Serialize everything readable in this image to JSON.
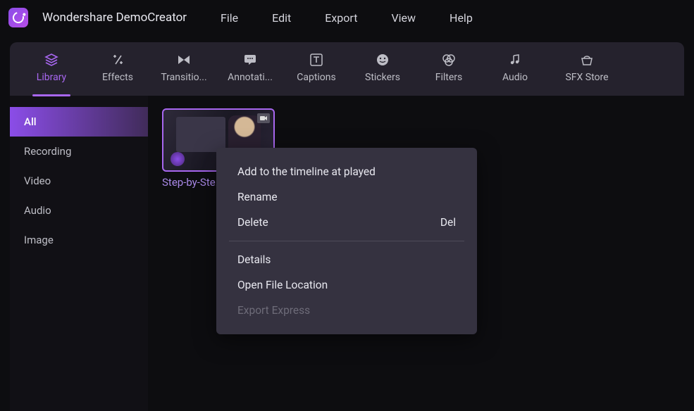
{
  "app": {
    "title": "Wondershare DemoCreator"
  },
  "menubar": [
    "File",
    "Edit",
    "Export",
    "View",
    "Help"
  ],
  "toolbar": [
    {
      "label": "Library",
      "active": true,
      "icon": "layers"
    },
    {
      "label": "Effects",
      "active": false,
      "icon": "sparkle"
    },
    {
      "label": "Transitio...",
      "active": false,
      "icon": "transition"
    },
    {
      "label": "Annotati...",
      "active": false,
      "icon": "annotation"
    },
    {
      "label": "Captions",
      "active": false,
      "icon": "text"
    },
    {
      "label": "Stickers",
      "active": false,
      "icon": "smile"
    },
    {
      "label": "Filters",
      "active": false,
      "icon": "filters"
    },
    {
      "label": "Audio",
      "active": false,
      "icon": "music"
    },
    {
      "label": "SFX Store",
      "active": false,
      "icon": "store"
    }
  ],
  "sidebar": [
    {
      "label": "All",
      "active": true
    },
    {
      "label": "Recording",
      "active": false
    },
    {
      "label": "Video",
      "active": false
    },
    {
      "label": "Audio",
      "active": false
    },
    {
      "label": "Image",
      "active": false
    }
  ],
  "clip": {
    "title": "Step-by-Ste..."
  },
  "context_menu": {
    "items1": [
      {
        "label": "Add to the timeline at played",
        "shortcut": ""
      },
      {
        "label": "Rename",
        "shortcut": ""
      },
      {
        "label": "Delete",
        "shortcut": "Del"
      }
    ],
    "items2": [
      {
        "label": "Details",
        "shortcut": "",
        "disabled": false
      },
      {
        "label": "Open File Location",
        "shortcut": "",
        "disabled": false
      },
      {
        "label": "Export Express",
        "shortcut": "",
        "disabled": true
      }
    ]
  }
}
